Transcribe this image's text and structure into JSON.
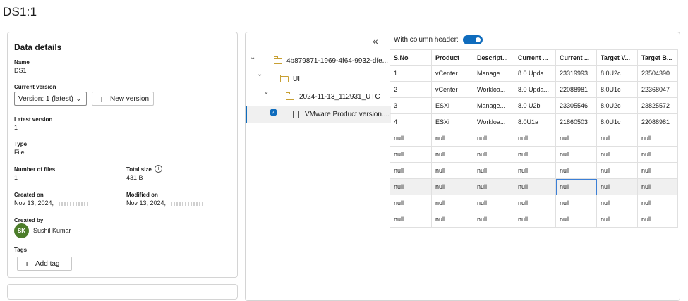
{
  "page": {
    "title": "DS1:1"
  },
  "details": {
    "heading": "Data details",
    "name_label": "Name",
    "name_value": "DS1",
    "current_version_label": "Current version",
    "version_select_value": "Version: 1 (latest)",
    "new_version_label": "New version",
    "latest_version_label": "Latest version",
    "latest_version_value": "1",
    "type_label": "Type",
    "type_value": "File",
    "num_files_label": "Number of files",
    "num_files_value": "1",
    "total_size_label": "Total size",
    "total_size_value": "431 B",
    "created_on_label": "Created on",
    "created_on_value": "Nov 13, 2024,",
    "modified_on_label": "Modified on",
    "modified_on_value": "Nov 13, 2024,",
    "created_by_label": "Created by",
    "created_by_initials": "SK",
    "created_by_name": "Sushil Kumar",
    "tags_label": "Tags",
    "add_tag_label": "Add tag"
  },
  "tree": {
    "items": [
      {
        "label": "4b879871-1969-4f64-9932-dfe..."
      },
      {
        "label": "UI"
      },
      {
        "label": "2024-11-13_112931_UTC"
      },
      {
        "label": "VMware Product version...."
      }
    ]
  },
  "preview": {
    "column_header_label": "With column header:",
    "column_header_on": true,
    "columns": [
      "S.No",
      "Product",
      "Descript...",
      "Current ...",
      "Current ...",
      "Target V...",
      "Target B..."
    ],
    "rows": [
      [
        "1",
        "vCenter",
        "Manage...",
        "8.0 Upda...",
        "23319993",
        "8.0U2c",
        "23504390"
      ],
      [
        "2",
        "vCenter",
        "Workloa...",
        "8.0 Upda...",
        "22088981",
        "8.0U1c",
        "22368047"
      ],
      [
        "3",
        "ESXi",
        "Manage...",
        "8.0 U2b",
        "23305546",
        "8.0U2c",
        "23825572"
      ],
      [
        "4",
        "ESXi",
        "Workloa...",
        "8.0U1a",
        "21860503",
        "8.0U1c",
        "22088981"
      ],
      [
        "null",
        "null",
        "null",
        "null",
        "null",
        "null",
        "null"
      ],
      [
        "null",
        "null",
        "null",
        "null",
        "null",
        "null",
        "null"
      ],
      [
        "null",
        "null",
        "null",
        "null",
        "null",
        "null",
        "null"
      ],
      [
        "null",
        "null",
        "null",
        "null",
        "null",
        "null",
        "null"
      ],
      [
        "null",
        "null",
        "null",
        "null",
        "null",
        "null",
        "null"
      ],
      [
        "null",
        "null",
        "null",
        "null",
        "null",
        "null",
        "null"
      ]
    ]
  },
  "colors": {
    "accent": "#0f6cbd",
    "avatar": "#4c7d2a",
    "folder": "#c8a033"
  }
}
